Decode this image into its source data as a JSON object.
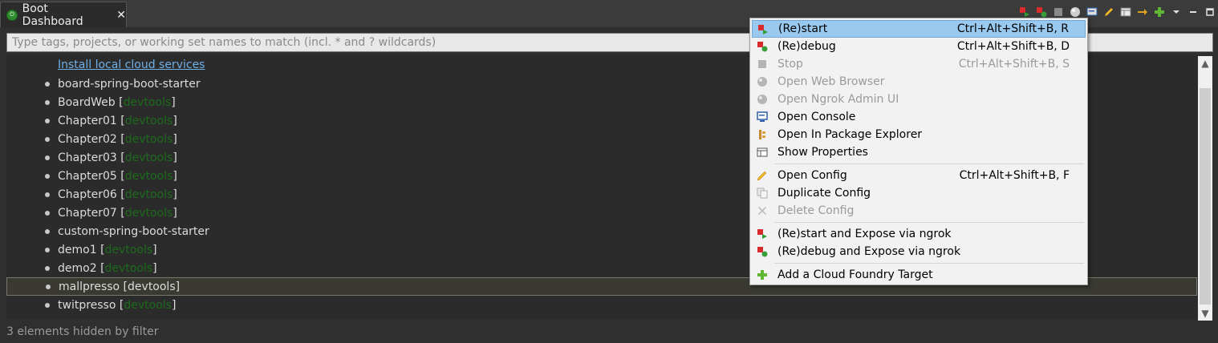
{
  "tab": {
    "title": "Boot Dashboard",
    "close": "✕"
  },
  "filter": {
    "placeholder": "Type tags, projects, or working set names to match (incl. * and ? wildcards)"
  },
  "tree": {
    "install_link": "Install local cloud services",
    "items": [
      {
        "name": "board-spring-boot-starter",
        "tag": ""
      },
      {
        "name": "BoardWeb",
        "tag": "devtools"
      },
      {
        "name": "Chapter01",
        "tag": "devtools"
      },
      {
        "name": "Chapter02",
        "tag": "devtools"
      },
      {
        "name": "Chapter03",
        "tag": "devtools"
      },
      {
        "name": "Chapter05",
        "tag": "devtools"
      },
      {
        "name": "Chapter06",
        "tag": "devtools"
      },
      {
        "name": "Chapter07",
        "tag": "devtools"
      },
      {
        "name": "custom-spring-boot-starter",
        "tag": ""
      },
      {
        "name": "demo1",
        "tag": "devtools"
      },
      {
        "name": "demo2",
        "tag": "devtools"
      },
      {
        "name": "mallpresso",
        "tag": "devtools",
        "selected": true
      },
      {
        "name": "twitpresso",
        "tag": "devtools"
      }
    ]
  },
  "status": "3 elements hidden by filter",
  "menu": {
    "items": [
      {
        "label": "(Re)start",
        "shortcut": "Ctrl+Alt+Shift+B, R",
        "icon": "restart-icon",
        "highlighted": true
      },
      {
        "label": "(Re)debug",
        "shortcut": "Ctrl+Alt+Shift+B, D",
        "icon": "debug-icon"
      },
      {
        "label": "Stop",
        "shortcut": "Ctrl+Alt+Shift+B, S",
        "icon": "stop-icon",
        "disabled": true
      },
      {
        "label": "Open Web Browser",
        "shortcut": "",
        "icon": "globe-icon",
        "disabled": true
      },
      {
        "label": "Open Ngrok Admin UI",
        "shortcut": "",
        "icon": "globe-icon",
        "disabled": true
      },
      {
        "label": "Open Console",
        "shortcut": "",
        "icon": "console-icon"
      },
      {
        "label": "Open In Package Explorer",
        "shortcut": "",
        "icon": "package-explorer-icon"
      },
      {
        "label": "Show Properties",
        "shortcut": "",
        "icon": "properties-icon",
        "separator_after": true
      },
      {
        "label": "Open Config",
        "shortcut": "Ctrl+Alt+Shift+B, F",
        "icon": "pencil-icon"
      },
      {
        "label": "Duplicate Config",
        "shortcut": "",
        "icon": "duplicate-icon"
      },
      {
        "label": "Delete Config",
        "shortcut": "",
        "icon": "delete-icon",
        "disabled": true,
        "separator_after": true
      },
      {
        "label": "(Re)start and Expose via ngrok",
        "shortcut": "",
        "icon": "restart-icon"
      },
      {
        "label": "(Re)debug and Expose via ngrok",
        "shortcut": "",
        "icon": "debug-icon",
        "separator_after": true
      },
      {
        "label": "Add a Cloud Foundry Target",
        "shortcut": "",
        "icon": "plus-icon"
      }
    ]
  },
  "colors": {
    "accent": "#99c9ef",
    "tag_green": "#1c6b1c",
    "link": "#6fb0e8",
    "background": "#2f2f2f"
  }
}
